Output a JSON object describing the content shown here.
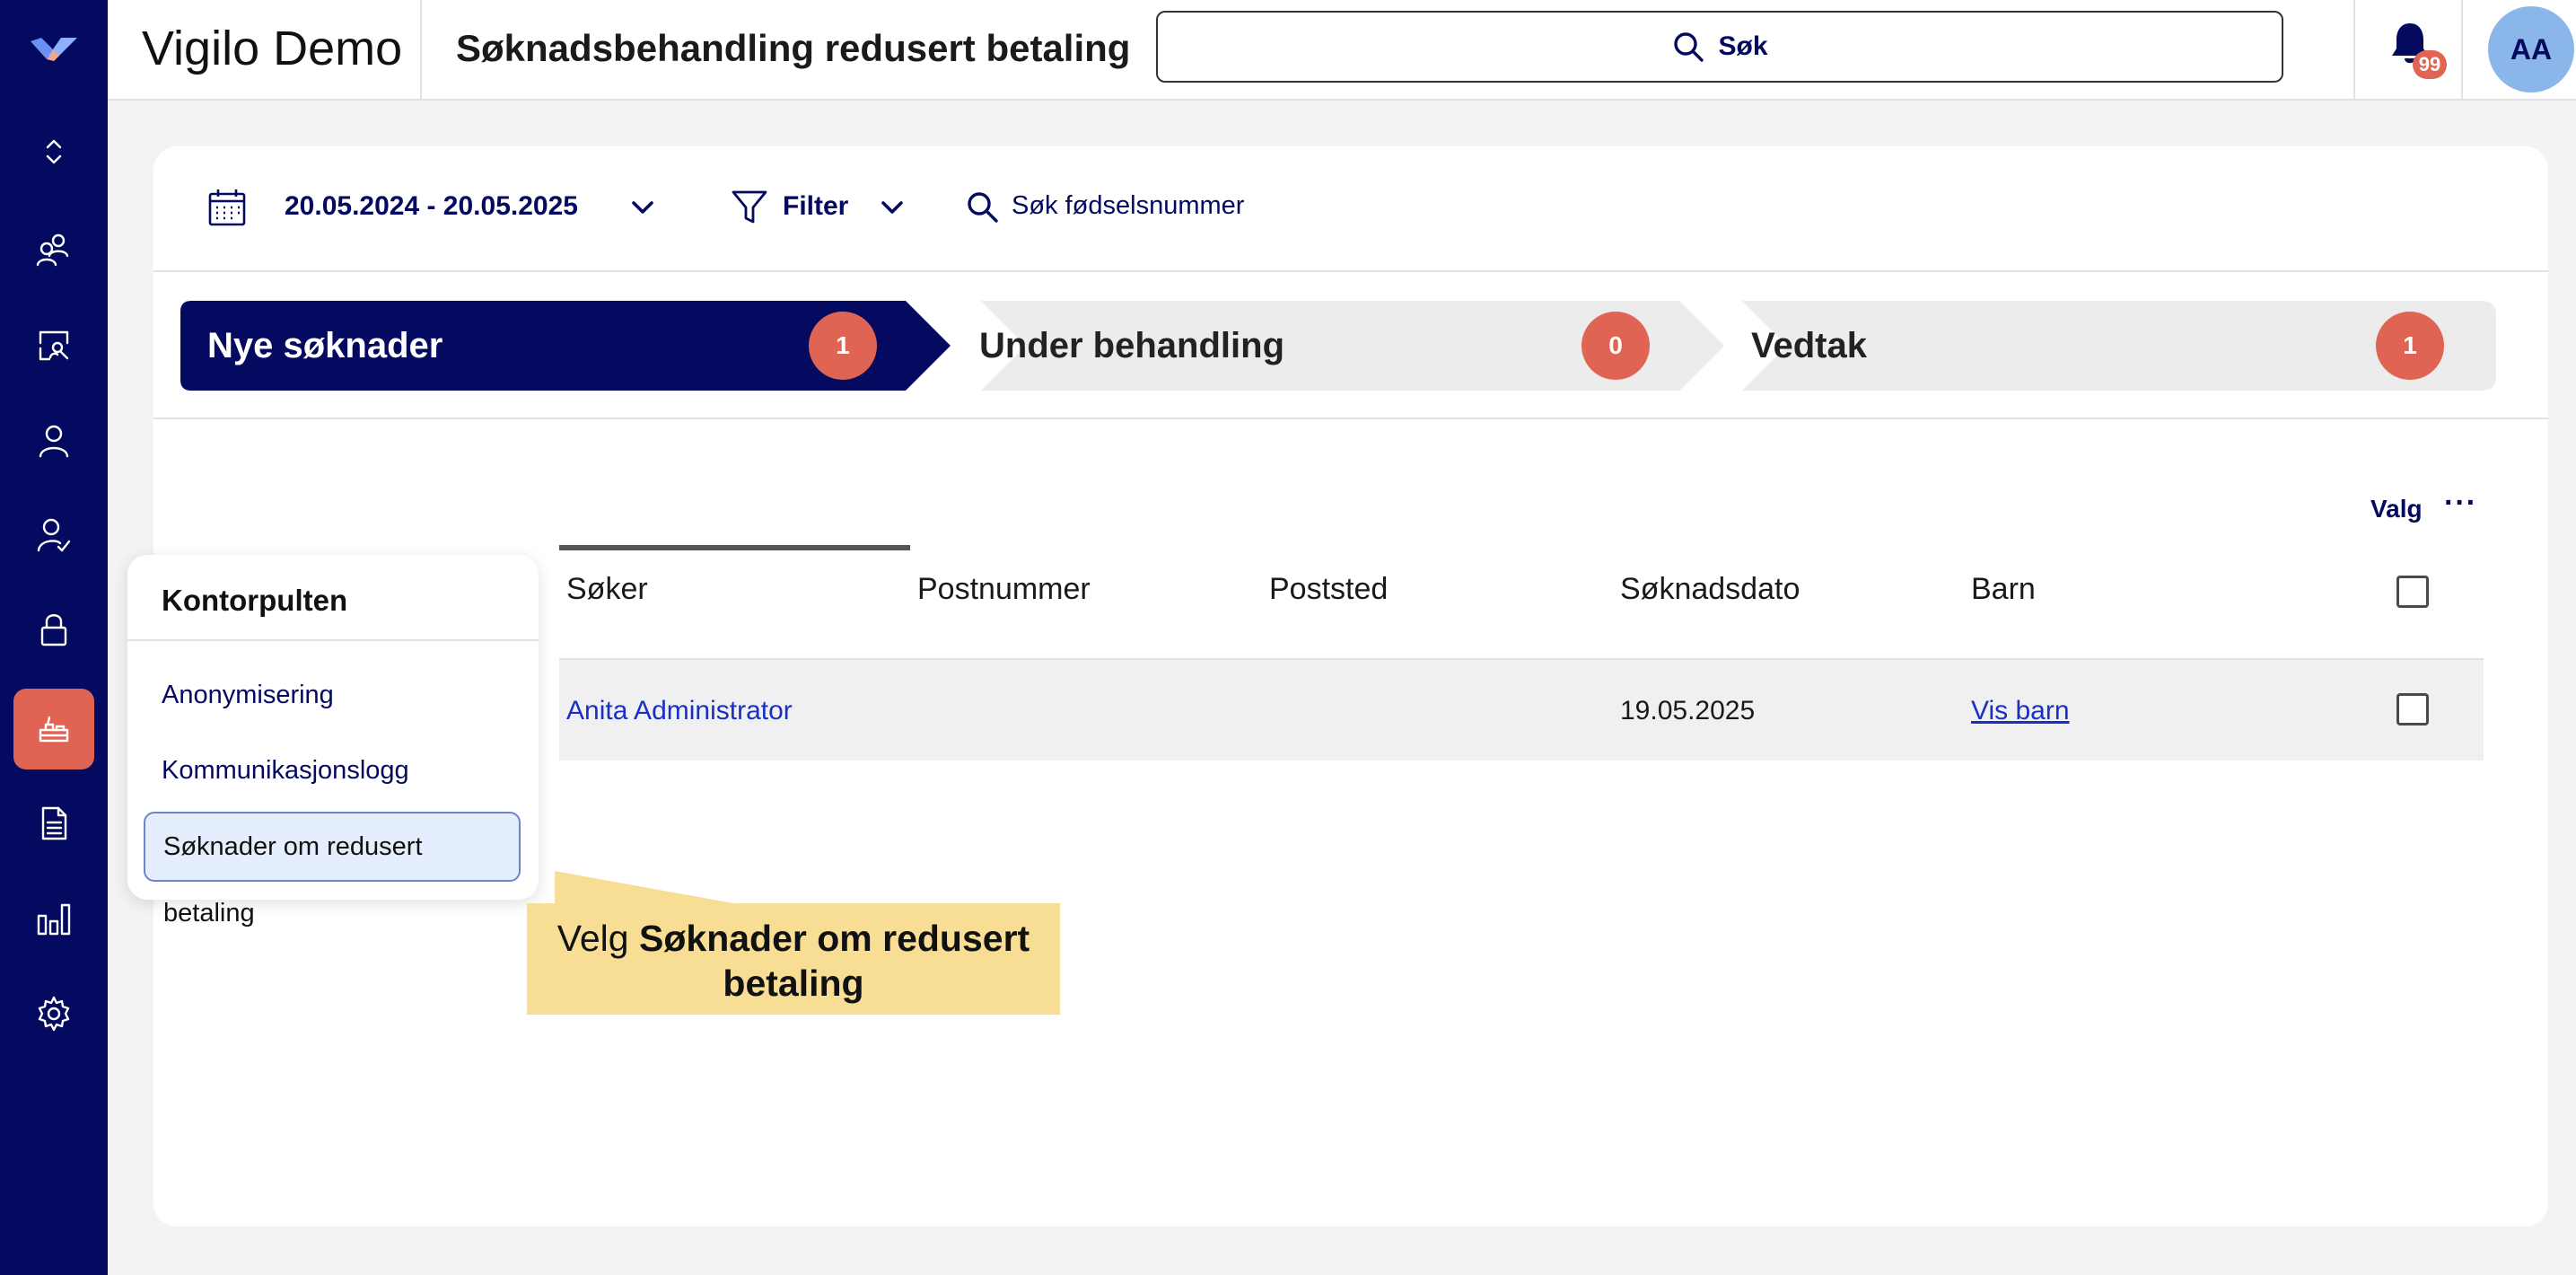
{
  "app": {
    "title": "Vigilo Demo",
    "page_title": "Søknadsbehandling redusert betaling"
  },
  "search": {
    "label": "Søk"
  },
  "notifications": {
    "count": "99"
  },
  "user": {
    "initials": "AA"
  },
  "sidebar": {
    "items": [
      {
        "icon": "collapse-icon"
      },
      {
        "icon": "people-icon"
      },
      {
        "icon": "search-person-icon"
      },
      {
        "icon": "person-icon"
      },
      {
        "icon": "person-check-icon"
      },
      {
        "icon": "lock-icon"
      },
      {
        "icon": "desk-icon",
        "active": true
      },
      {
        "icon": "document-icon"
      },
      {
        "icon": "bar-chart-icon"
      },
      {
        "icon": "gear-icon"
      }
    ]
  },
  "filters": {
    "date_range": "20.05.2024 - 20.05.2025",
    "filter_label": "Filter",
    "fodsel_label": "Søk fødselsnummer"
  },
  "steps": [
    {
      "label": "Nye søknader",
      "count": "1"
    },
    {
      "label": "Under behandling",
      "count": "0"
    },
    {
      "label": "Vedtak",
      "count": "1"
    }
  ],
  "table": {
    "valg_label": "Valg",
    "valg_more": "···",
    "columns": [
      "Søker",
      "Postnummer",
      "Poststed",
      "Søknadsdato",
      "Barn"
    ],
    "rows": [
      {
        "soker": "Anita Administrator",
        "postnummer": "",
        "poststed": "",
        "soknadsdato": "19.05.2025",
        "barn": "Vis barn"
      }
    ]
  },
  "popup": {
    "title": "Kontorpulten",
    "items": [
      "Anonymisering",
      "Kommunikasjonslogg",
      "Søknader om redusert betaling"
    ]
  },
  "callout": {
    "prefix": "Velg ",
    "bold": "Søknader om redusert betaling"
  },
  "colors": {
    "sidebar_bg": "#030a5f",
    "accent": "#e06454",
    "active_step": "#030a5f",
    "inactive_step": "#ececec",
    "callout": "#f8de95",
    "avatar": "#8ab6ea"
  }
}
